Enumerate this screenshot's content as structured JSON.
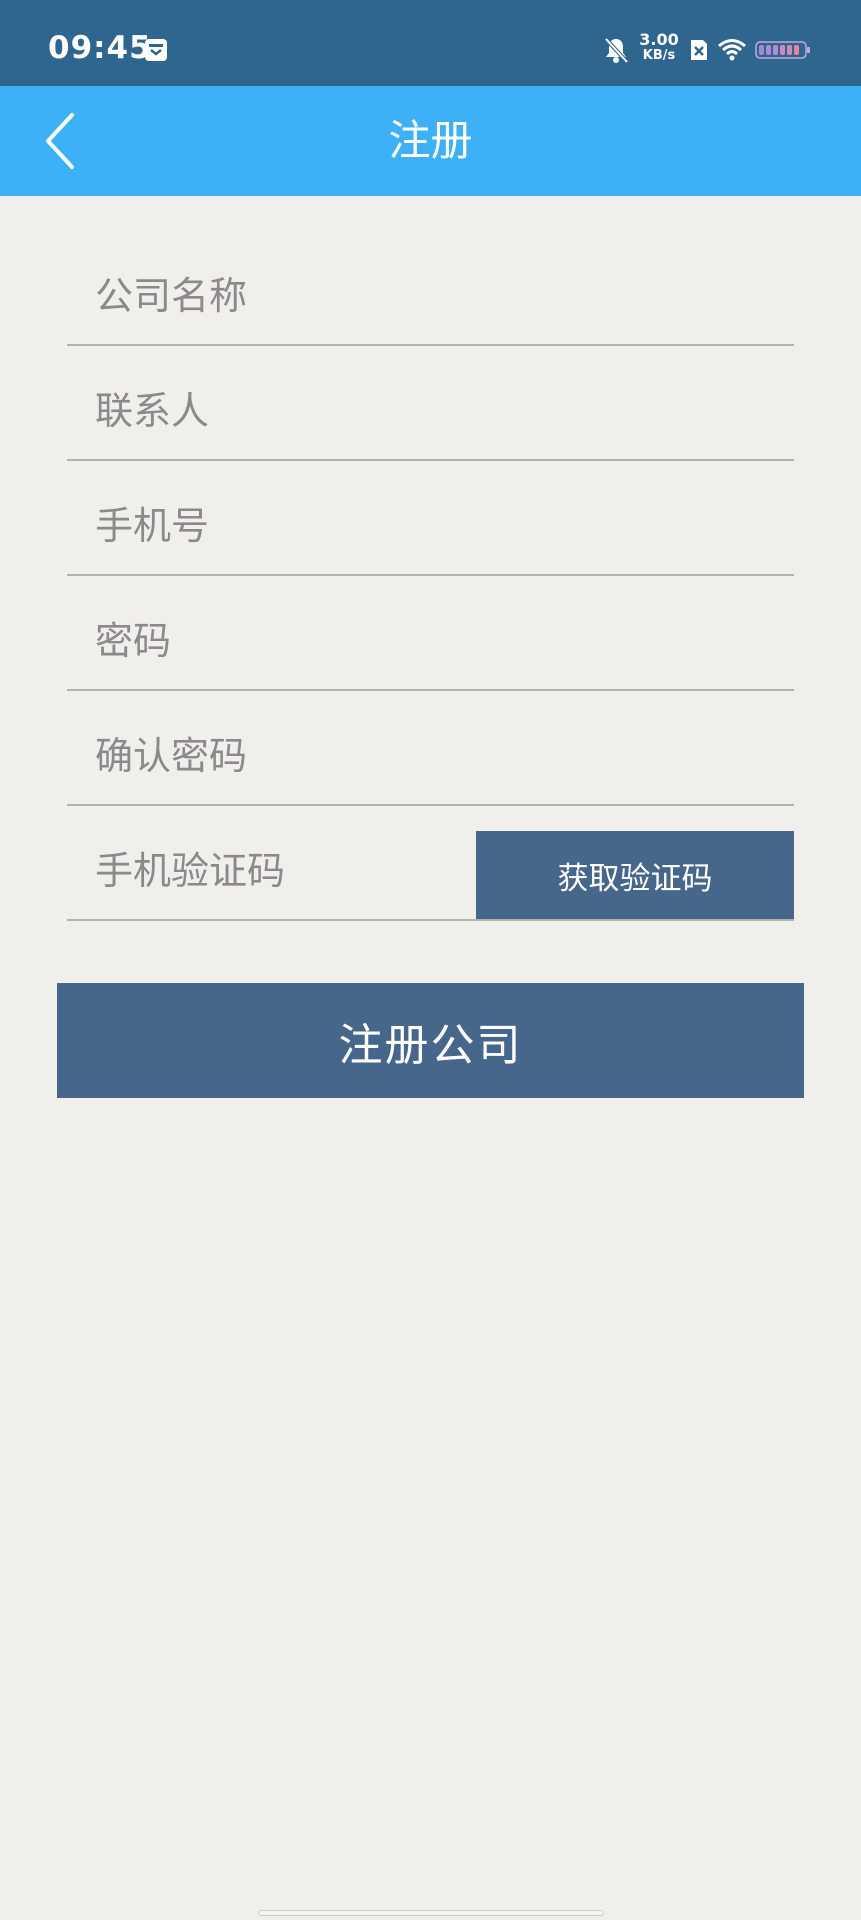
{
  "status_bar": {
    "time": "09:45",
    "net_speed_value": "3.00",
    "net_speed_unit": "KB/s",
    "icons": [
      "app-notification-icon",
      "bell-muted-icon",
      "sim-off-icon",
      "wifi-icon",
      "battery-icon"
    ]
  },
  "app_bar": {
    "title": "注册",
    "back_icon": "chevron-left-icon"
  },
  "form": {
    "company_name_placeholder": "公司名称",
    "contact_placeholder": "联系人",
    "phone_placeholder": "手机号",
    "password_placeholder": "密码",
    "confirm_password_placeholder": "确认密码",
    "sms_code_placeholder": "手机验证码",
    "get_code_label": "获取验证码",
    "submit_label": "注册公司"
  },
  "colors": {
    "status_bar": "#2e6690",
    "app_bar": "#3db0f7",
    "button": "#46668c",
    "background": "#f1efec"
  }
}
